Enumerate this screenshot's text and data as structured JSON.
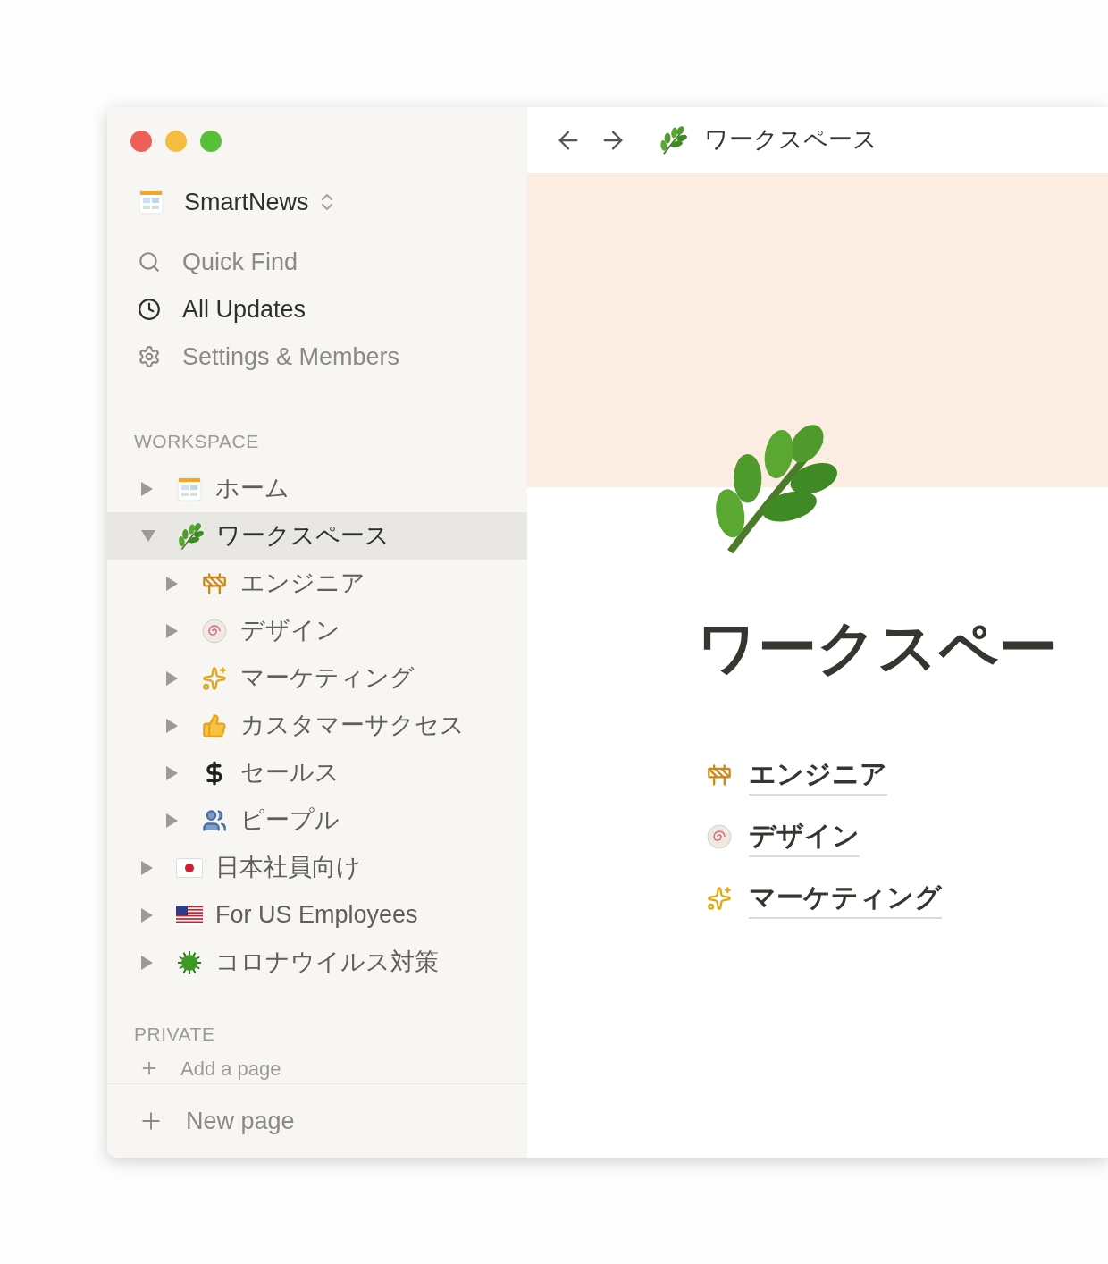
{
  "sidebar": {
    "workspace_switcher": {
      "name": "SmartNews"
    },
    "nav": [
      {
        "label": "Quick Find",
        "selected": false
      },
      {
        "label": "All Updates",
        "selected": true
      },
      {
        "label": "Settings & Members",
        "selected": false
      }
    ],
    "workspace": {
      "heading": "WORKSPACE",
      "pages": [
        {
          "label": "ホーム",
          "expanded": false,
          "selected": false
        },
        {
          "label": "ワークスペース",
          "expanded": true,
          "selected": true,
          "children": [
            {
              "label": "エンジニア",
              "expanded": false,
              "selected": false
            },
            {
              "label": "デザイン",
              "expanded": false,
              "selected": false
            },
            {
              "label": "マーケティング",
              "expanded": false,
              "selected": false
            },
            {
              "label": "カスタマーサクセス",
              "expanded": false,
              "selected": false
            },
            {
              "label": "セールス",
              "expanded": false,
              "selected": false
            },
            {
              "label": "ピープル",
              "expanded": false,
              "selected": false
            }
          ]
        },
        {
          "label": "日本社員向け",
          "expanded": false,
          "selected": false
        },
        {
          "label": "For US Employees",
          "expanded": false,
          "selected": false
        },
        {
          "label": "コロナウイルス対策",
          "expanded": false,
          "selected": false
        }
      ]
    },
    "private": {
      "heading": "PRIVATE",
      "add_page": "Add a page"
    },
    "new_page": "New page"
  },
  "topbar": {
    "breadcrumb": "ワークスペース"
  },
  "page": {
    "title": "ワークスペー",
    "links": [
      "エンジニア",
      "デザイン",
      "マーケティング"
    ]
  }
}
